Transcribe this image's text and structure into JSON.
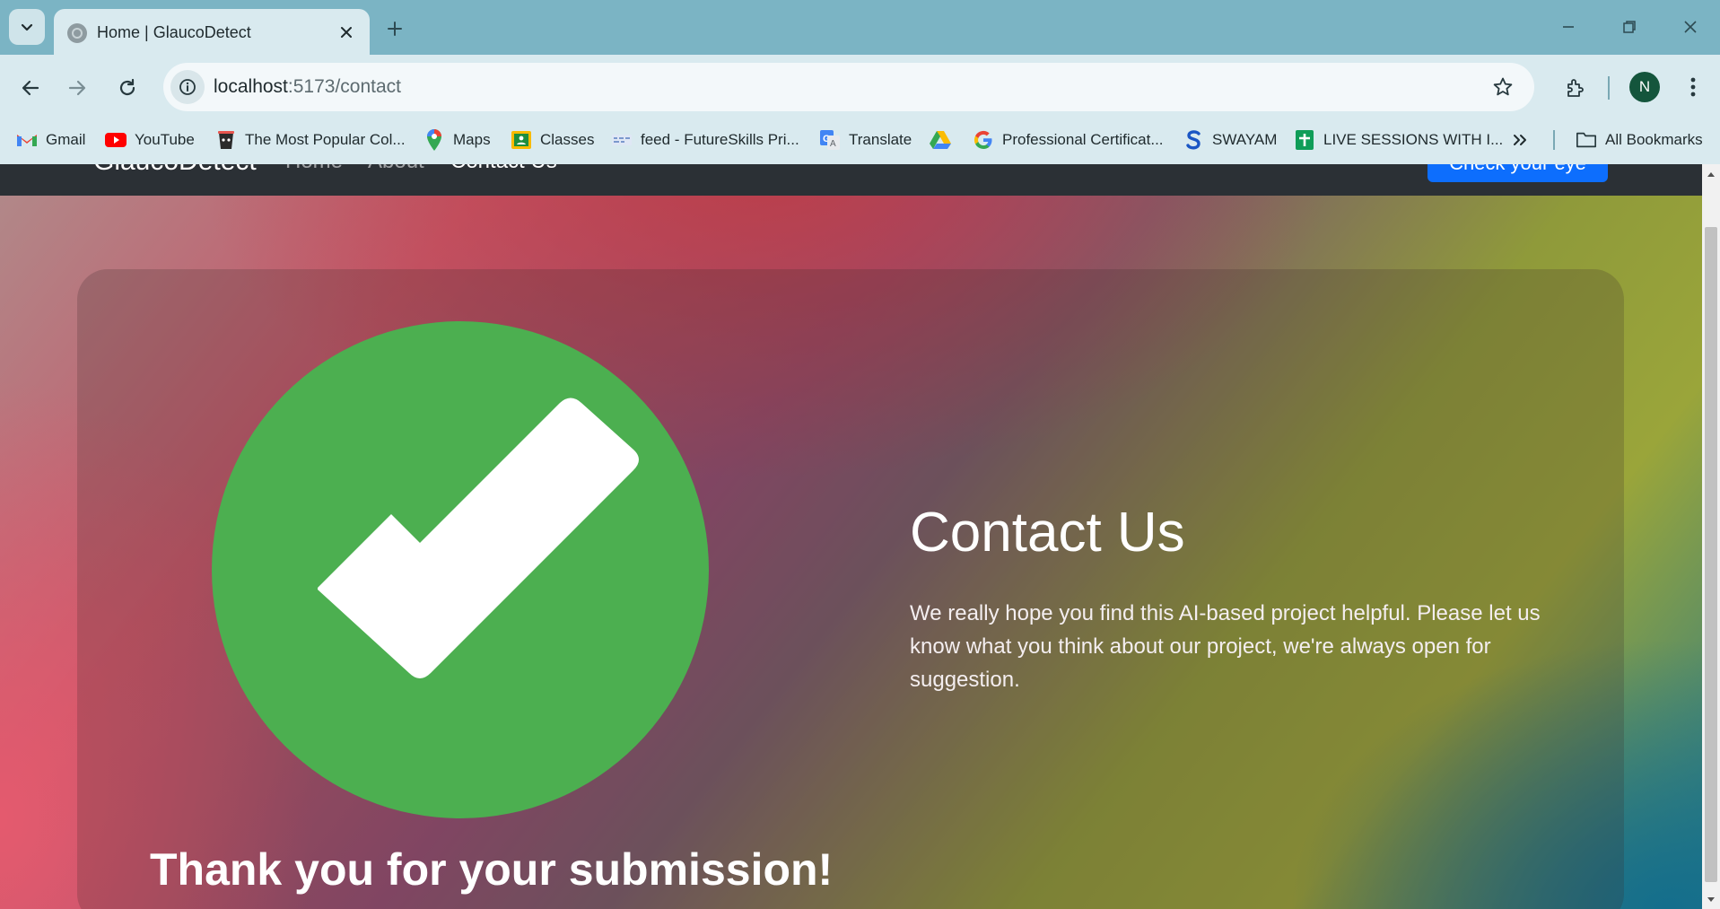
{
  "browser": {
    "tab": {
      "title": "Home | GlaucoDetect"
    },
    "url": {
      "host": "localhost",
      "path": ":5173/contact"
    },
    "profile_initial": "N",
    "bookmarks": [
      {
        "label": "Gmail",
        "icon": "gmail-icon"
      },
      {
        "label": "YouTube",
        "icon": "youtube-icon"
      },
      {
        "label": "The Most Popular Col...",
        "icon": "cup-icon"
      },
      {
        "label": "Maps",
        "icon": "maps-icon"
      },
      {
        "label": "Classes",
        "icon": "classroom-icon"
      },
      {
        "label": "feed - FutureSkills Pri...",
        "icon": "futureskills-icon"
      },
      {
        "label": "Translate",
        "icon": "translate-icon"
      },
      {
        "label": "",
        "icon": "drive-icon"
      },
      {
        "label": "Professional Certificat...",
        "icon": "google-icon"
      },
      {
        "label": "SWAYAM",
        "icon": "swayam-icon"
      },
      {
        "label": "LIVE SESSIONS WITH I...",
        "icon": "sheets-icon"
      }
    ],
    "all_bookmarks_label": "All Bookmarks"
  },
  "site": {
    "brand": "GlaucoDetect",
    "nav": [
      "Home",
      "About",
      "Contact Us"
    ],
    "cta_label": "Check your eye"
  },
  "content": {
    "thanks": "Thank you for your submission!",
    "title": "Contact Us",
    "text": "We really hope you find this AI-based project helpful. Please let us know what you think about our project, we're always open for suggestion."
  },
  "colors": {
    "check_green": "#4caf50",
    "cta_blue": "#0d6efd",
    "site_nav_bg": "#2b3035",
    "browser_frame": "#7bb4c4"
  }
}
